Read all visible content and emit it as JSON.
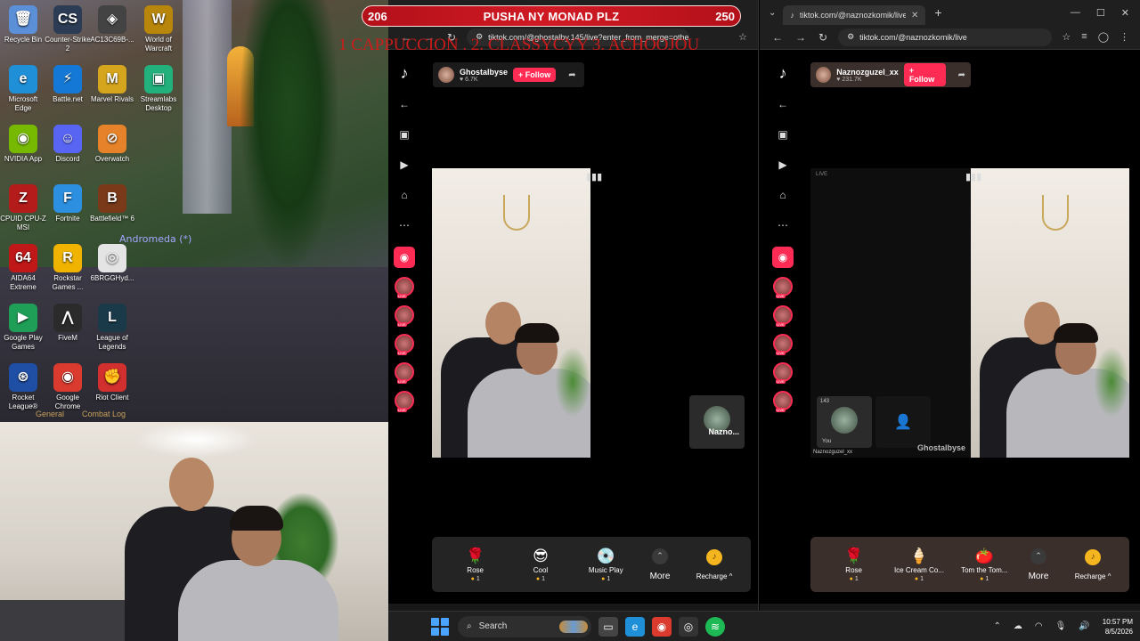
{
  "banner": {
    "left_count": "206",
    "title": "PUSHA NY MONAD PLZ",
    "right_count": "250"
  },
  "ticker": "1 CAPPUCCION . 2. CLASSYCYY 3. ACHOOJOU",
  "desktop": {
    "icons": [
      {
        "label": "Recycle Bin",
        "glyph": "🗑",
        "color": "#5b8fd8"
      },
      {
        "label": "Counter-Strike 2",
        "glyph": "CS",
        "color": "#2c3c55"
      },
      {
        "label": "AC13C69B-...",
        "glyph": "◈",
        "color": "#434343"
      },
      {
        "label": "World of Warcraft",
        "glyph": "W",
        "color": "#b8860b"
      },
      {
        "label": "Microsoft Edge",
        "glyph": "e",
        "color": "#1f8fd8"
      },
      {
        "label": "Battle.net",
        "glyph": "⚡",
        "color": "#1479d6"
      },
      {
        "label": "Marvel Rivals",
        "glyph": "M",
        "color": "#d6a51e"
      },
      {
        "label": "Streamlabs Desktop",
        "glyph": "▣",
        "color": "#22b07d"
      },
      {
        "label": "NVIDIA App",
        "glyph": "◉",
        "color": "#76b900"
      },
      {
        "label": "Discord",
        "glyph": "☺",
        "color": "#5865f2"
      },
      {
        "label": "Overwatch",
        "glyph": "⊘",
        "color": "#e6832a"
      },
      {
        "label": "CPUID CPU-Z MSI",
        "glyph": "Z",
        "color": "#b41c1c"
      },
      {
        "label": "Fortnite",
        "glyph": "F",
        "color": "#2d8fe0"
      },
      {
        "label": "Battlefield™ 6",
        "glyph": "B",
        "color": "#7a3a1a"
      },
      {
        "label": "AIDA64 Extreme",
        "glyph": "64",
        "color": "#c01818"
      },
      {
        "label": "Rockstar Games ...",
        "glyph": "R",
        "color": "#f0b400"
      },
      {
        "label": "6BRGGHyd...",
        "glyph": "◎",
        "color": "#e4e4e4"
      },
      {
        "label": "Google Play Games",
        "glyph": "▶",
        "color": "#1f9e57"
      },
      {
        "label": "FiveM",
        "glyph": "⋀",
        "color": "#2b2b2b"
      },
      {
        "label": "League of Legends",
        "glyph": "L",
        "color": "#1a3a4a"
      },
      {
        "label": "Rocket League®",
        "glyph": "⊛",
        "color": "#1e4fa5"
      },
      {
        "label": "Google Chrome",
        "glyph": "◉",
        "color": "#db3b2f"
      },
      {
        "label": "Riot Client",
        "glyph": "✊",
        "color": "#d22f2f"
      }
    ],
    "nameplate": "Andromeda (*)",
    "game_tabs": [
      "General",
      "Combat Log"
    ]
  },
  "left_browser": {
    "url": "tiktok.com/@ghostalby.145/live?enter_from_merge=others_home...",
    "host": {
      "name": "Ghostalbyse",
      "likes": "♥ 6.7K",
      "follow": "+ Follow"
    },
    "guest": {
      "name": "Nazno..."
    },
    "gifts": [
      {
        "name": "Rose",
        "glyph": "🌹",
        "price": "1"
      },
      {
        "name": "Cool",
        "glyph": "😎",
        "price": "1"
      },
      {
        "name": "Music Play",
        "glyph": "💿",
        "price": "1"
      }
    ],
    "more": "More",
    "recharge": "Recharge ^"
  },
  "right_browser": {
    "tab_title": "tiktok.com/@naznozkomik/live",
    "url": "tiktok.com/@naznozkomik/live",
    "host": {
      "name": "Naznozguzel_xx",
      "likes": "♥ 231.7K",
      "follow": "+ Follow"
    },
    "live_label": "LIVE",
    "guest_count": "143",
    "guest_name_a": "Naznozguzel_xx",
    "guest_tag": "You",
    "guest_name_b": "Ghostalbyse",
    "gifts": [
      {
        "name": "Rose",
        "glyph": "🌹",
        "price": "1"
      },
      {
        "name": "Ice Cream Co...",
        "glyph": "🍦",
        "price": "1"
      },
      {
        "name": "Tom the Tom...",
        "glyph": "🍅",
        "price": "1"
      }
    ],
    "more": "More",
    "recharge": "Recharge ^"
  },
  "taskbar": {
    "search": "Search",
    "time": "10:57 PM",
    "date": "8/5/2026"
  },
  "colors": {
    "tiktok_red": "#fe2c55",
    "banner_red": "#c7141e",
    "coin": "#f5b51f"
  }
}
